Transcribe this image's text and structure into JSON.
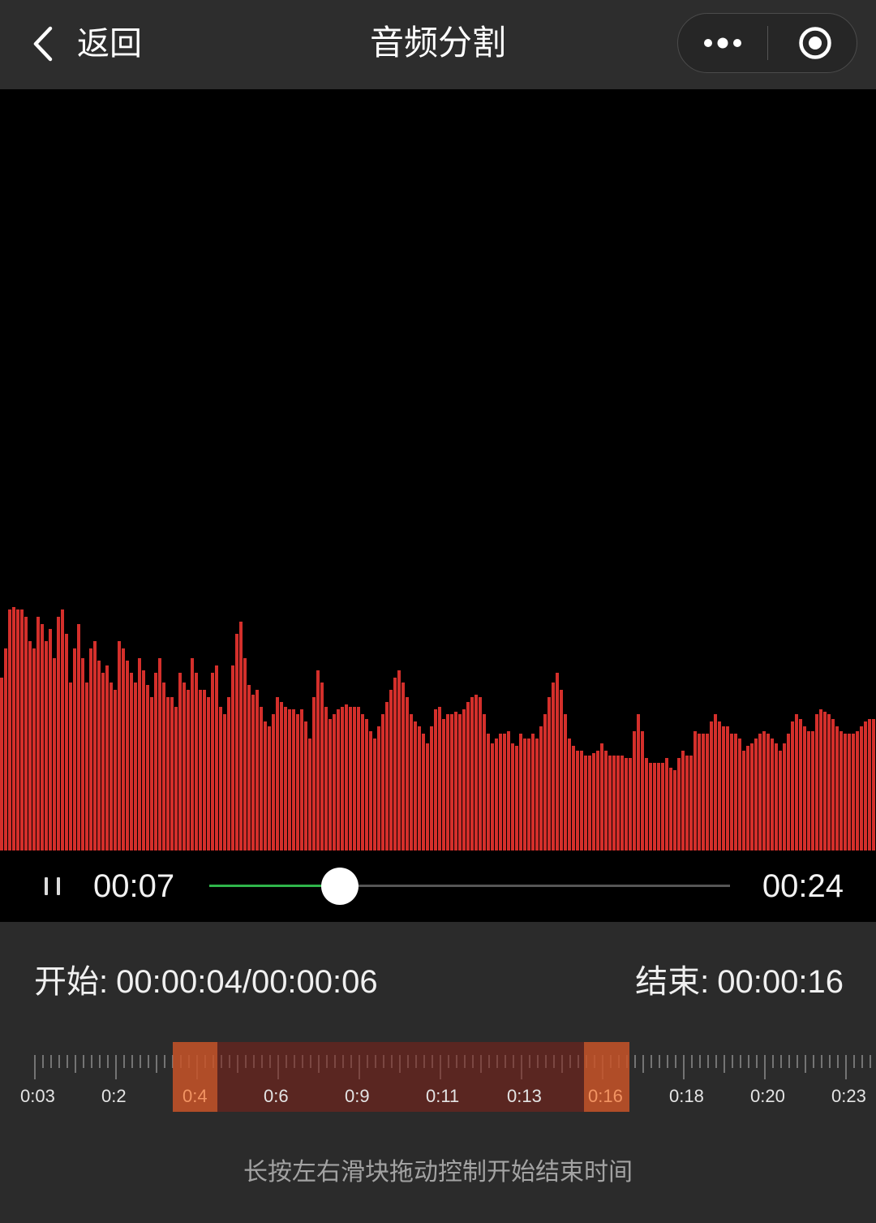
{
  "nav": {
    "back_icon": "chevron-left-icon",
    "back_label": "返回",
    "title": "音频分割",
    "more_icon": "more-dots-icon",
    "close_icon": "target-circle-icon"
  },
  "waveform": {
    "color": "#d42f2b",
    "amplitudes": [
      71,
      83,
      99,
      100,
      99,
      99,
      96,
      86,
      83,
      96,
      93,
      86,
      91,
      79,
      96,
      99,
      89,
      69,
      83,
      93,
      79,
      69,
      83,
      86,
      78,
      73,
      76,
      69,
      66,
      86,
      83,
      78,
      73,
      69,
      79,
      74,
      68,
      63,
      73,
      79,
      69,
      63,
      63,
      59,
      73,
      69,
      66,
      79,
      73,
      66,
      66,
      63,
      73,
      76,
      59,
      56,
      63,
      76,
      89,
      94,
      79,
      68,
      64,
      66,
      59,
      53,
      51,
      56,
      63,
      61,
      59,
      58,
      58,
      56,
      58,
      53,
      46,
      63,
      74,
      69,
      59,
      54,
      56,
      58,
      59,
      60,
      59,
      59,
      59,
      56,
      54,
      49,
      46,
      51,
      56,
      61,
      66,
      71,
      74,
      69,
      63,
      56,
      53,
      51,
      48,
      44,
      51,
      58,
      59,
      54,
      56,
      56,
      57,
      56,
      58,
      61,
      63,
      64,
      63,
      56,
      48,
      44,
      46,
      48,
      48,
      49,
      44,
      43,
      48,
      46,
      46,
      48,
      46,
      51,
      56,
      63,
      69,
      73,
      66,
      56,
      46,
      43,
      41,
      41,
      39,
      39,
      40,
      41,
      44,
      41,
      39,
      39,
      39,
      39,
      38,
      38,
      49,
      56,
      49,
      38,
      36,
      36,
      36,
      36,
      38,
      34,
      33,
      38,
      41,
      39,
      39,
      49,
      48,
      48,
      48,
      53,
      56,
      53,
      51,
      51,
      48,
      48,
      46,
      41,
      43,
      44,
      46,
      48,
      49,
      48,
      46,
      44,
      41,
      44,
      48,
      53,
      56,
      54,
      51,
      49,
      49,
      56,
      58,
      57,
      56,
      54,
      51,
      49,
      48,
      48,
      48,
      49,
      51,
      53,
      54,
      54
    ]
  },
  "player": {
    "state_icon": "pause-icon",
    "current_time": "00:07",
    "total_time": "00:24",
    "progress_fraction": 0.25,
    "played_color": "#2fb54a"
  },
  "range": {
    "start_label": "开始:",
    "start_value": "00:00:04/00:00:06",
    "end_label": "结束:",
    "end_value": "00:00:16"
  },
  "timeline": {
    "labels": [
      "0:03",
      "0:2",
      "0:4",
      "0:6",
      "0:9",
      "0:11",
      "0:13",
      "0:16",
      "0:18",
      "0:20",
      "0:23"
    ],
    "selection_color": "#b04e28"
  },
  "hint": "长按左右滑块拖动控制开始结束时间"
}
